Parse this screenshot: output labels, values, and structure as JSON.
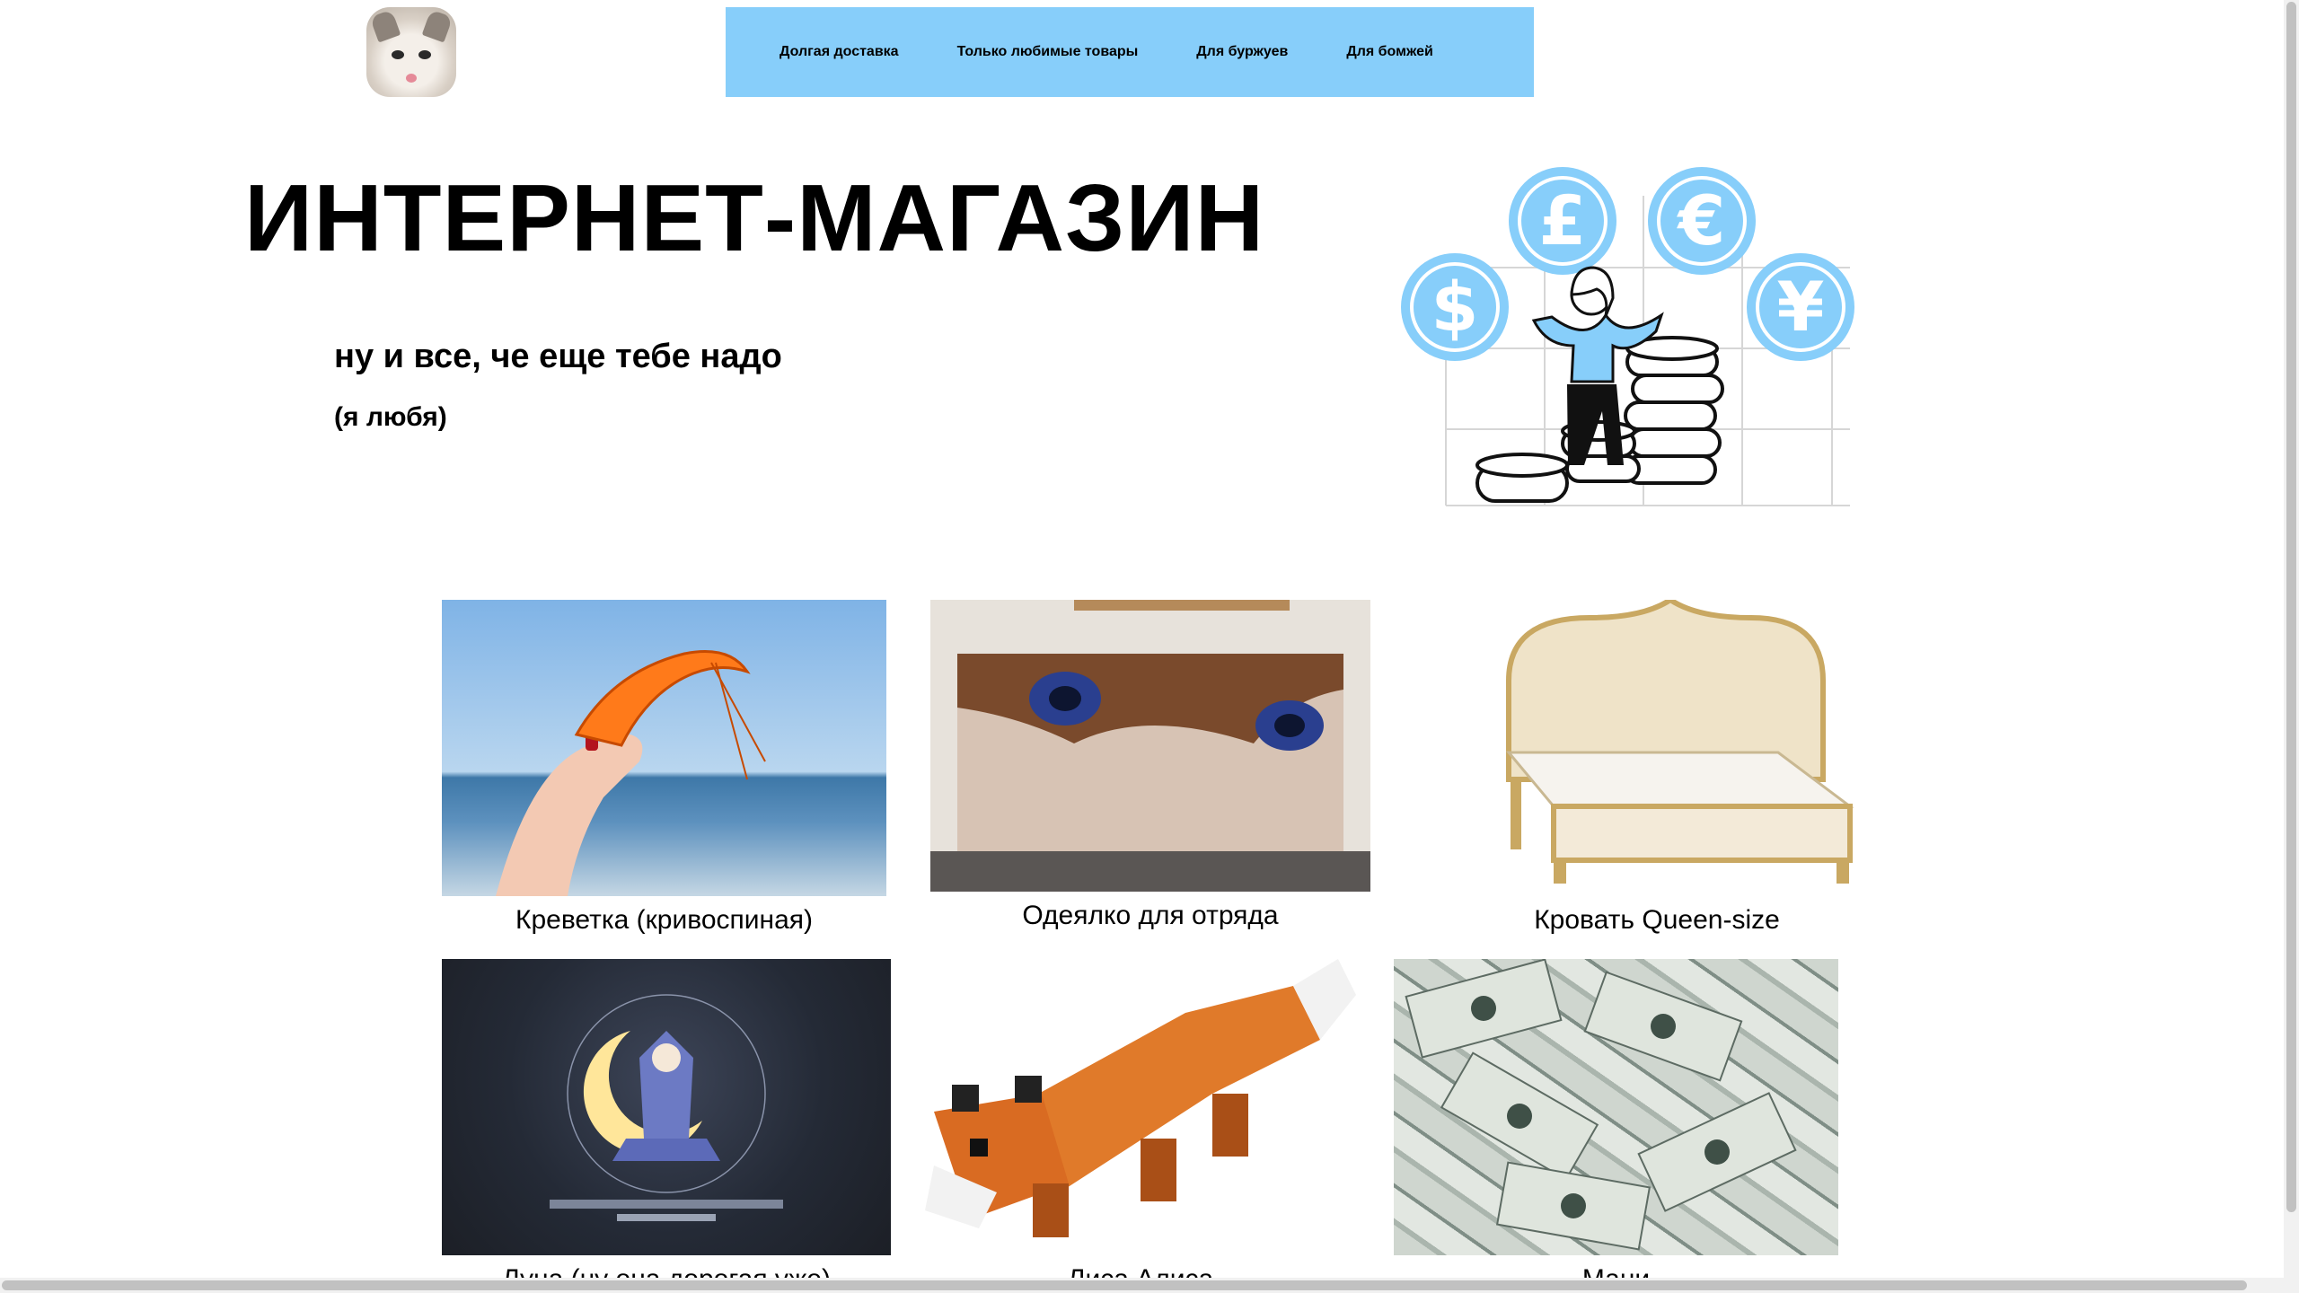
{
  "nav": {
    "items": [
      {
        "label": "Долгая доставка"
      },
      {
        "label": "Только любимые товары"
      },
      {
        "label": "Для буржуев"
      },
      {
        "label": "Для бомжей"
      }
    ]
  },
  "hero": {
    "title": "ИНТЕРНЕТ-МАГАЗИН",
    "subtitle": "ну и все, че еще тебе надо",
    "note": "(я любя)"
  },
  "illustration": {
    "coins": [
      "£",
      "€",
      "$",
      "¥"
    ],
    "accent": "#87cefa"
  },
  "products": [
    {
      "caption": "Креветка (кривоспиная)"
    },
    {
      "caption": "Одеялко для отряда"
    },
    {
      "caption": "Кровать Queen-size"
    },
    {
      "caption": "Луна (ну она дорогая уже)"
    },
    {
      "caption": "Лиса Алиса"
    },
    {
      "caption": "Мани"
    }
  ],
  "colors": {
    "nav_background": "#87cefa",
    "page_background": "#ffffff",
    "text": "#000000"
  }
}
